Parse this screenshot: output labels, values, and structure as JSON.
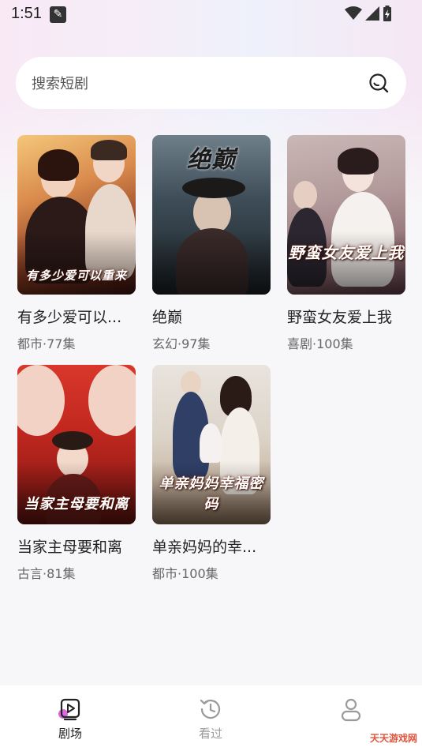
{
  "status_bar": {
    "time": "1:51"
  },
  "search": {
    "placeholder": "搜索短剧"
  },
  "dramas": [
    {
      "title": "有多少爱可以...",
      "meta": "都市·77集",
      "poster_text": "有多少爱可以重来"
    },
    {
      "title": "绝巅",
      "meta": "玄幻·97集",
      "poster_text": "绝巅"
    },
    {
      "title": "野蛮女友爱上我",
      "meta": "喜剧·100集",
      "poster_text": "野蛮女友爱上我"
    },
    {
      "title": "当家主母要和离",
      "meta": "古言·81集",
      "poster_text": "当家主母要和离"
    },
    {
      "title": "单亲妈妈的幸...",
      "meta": "都市·100集",
      "poster_text": "单亲妈妈幸福密码"
    }
  ],
  "tab_bar": {
    "tabs": [
      {
        "label": "剧场",
        "icon": "play-square-icon",
        "active": true
      },
      {
        "label": "看过",
        "icon": "history-clock-icon",
        "active": false
      },
      {
        "label": "",
        "icon": "profile-person-icon",
        "active": false
      }
    ]
  },
  "watermark": {
    "text": "天天游戏网"
  },
  "colors": {
    "accent": "#d44fd8",
    "active_tab": "#222222",
    "inactive_tab": "#9a9a9a"
  }
}
